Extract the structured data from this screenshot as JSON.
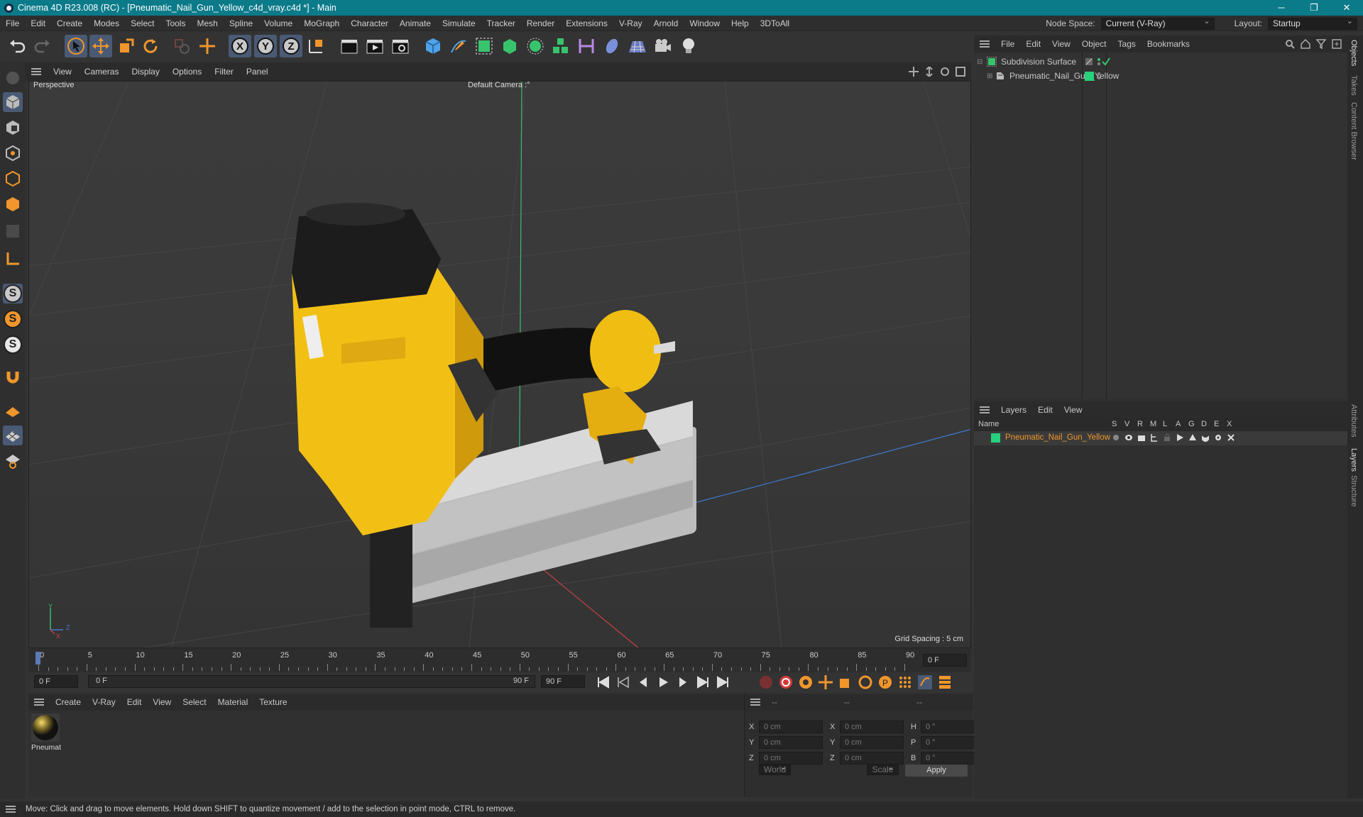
{
  "window": {
    "title": "Cinema 4D R23.008 (RC) - [Pneumatic_Nail_Gun_Yellow_c4d_vray.c4d *] - Main",
    "minimize": "─",
    "maximize": "❐",
    "close": "✕"
  },
  "menubar": {
    "items": [
      "File",
      "Edit",
      "Create",
      "Modes",
      "Select",
      "Tools",
      "Mesh",
      "Spline",
      "Volume",
      "MoGraph",
      "Character",
      "Animate",
      "Simulate",
      "Tracker",
      "Render",
      "Extensions",
      "V-Ray",
      "Arnold",
      "Window",
      "Help",
      "3DToAll"
    ],
    "node_space_label": "Node Space:",
    "node_space_value": "Current (V-Ray)",
    "layout_label": "Layout:",
    "layout_value": "Startup"
  },
  "toolbar": {
    "axis_x": "X",
    "axis_y": "Y",
    "axis_z": "Z"
  },
  "viewport": {
    "menu": [
      "View",
      "Cameras",
      "Display",
      "Options",
      "Filter",
      "Panel"
    ],
    "view_name": "Perspective",
    "camera": "Default Camera",
    "camera_suffix": ":°",
    "grid_spacing": "Grid Spacing : 5 cm",
    "axis_y": "Y",
    "axis_z": "Z",
    "axis_x": "X"
  },
  "timeline": {
    "ticks": [
      "0",
      "5",
      "10",
      "15",
      "20",
      "25",
      "30",
      "35",
      "40",
      "45",
      "50",
      "55",
      "60",
      "65",
      "70",
      "75",
      "80",
      "85",
      "90"
    ],
    "current_frame_right": "0 F"
  },
  "transport": {
    "start_frame": "0 F",
    "range_start": "0 F",
    "range_end": "90 F",
    "end_frame": "90 F"
  },
  "material_manager": {
    "menu": [
      "Create",
      "V-Ray",
      "Edit",
      "View",
      "Select",
      "Material",
      "Texture"
    ],
    "material_name": "Pneumat"
  },
  "coordinates": {
    "header": [
      "--",
      "--",
      "--"
    ],
    "rows": [
      {
        "a": "X",
        "av": "0 cm",
        "b": "X",
        "bv": "0 cm",
        "c": "H",
        "cv": "0 °"
      },
      {
        "a": "Y",
        "av": "0 cm",
        "b": "Y",
        "bv": "0 cm",
        "c": "P",
        "cv": "0 °"
      },
      {
        "a": "Z",
        "av": "0 cm",
        "b": "Z",
        "bv": "0 cm",
        "c": "B",
        "cv": "0 °"
      }
    ],
    "mode1": "World",
    "mode2": "Scale",
    "apply": "Apply"
  },
  "object_manager": {
    "menu": [
      "File",
      "Edit",
      "View",
      "Object",
      "Tags",
      "Bookmarks"
    ],
    "objects": [
      "Subdivision Surface",
      "Pneumatic_Nail_Gun_Yellow"
    ]
  },
  "layer_manager": {
    "menu": [
      "Layers",
      "Edit",
      "View"
    ],
    "columns": [
      "Name",
      "S",
      "V",
      "R",
      "M",
      "L",
      "A",
      "G",
      "D",
      "E",
      "X"
    ],
    "layer_name": "Pneumatic_Nail_Gun_Yellow",
    "layer_color": "#26d07c"
  },
  "side_tabs": [
    "Objects",
    "Takes",
    "Content Browser",
    "Attributes",
    "Layers",
    "Structure"
  ],
  "status": "Move: Click and drag to move elements. Hold down SHIFT to quantize movement / add to the selection in point mode, CTRL to remove.",
  "colors": {
    "titlebar": "#0b7a89",
    "accent_orange": "#f0962c",
    "selection_blue": "#4a5a75"
  }
}
